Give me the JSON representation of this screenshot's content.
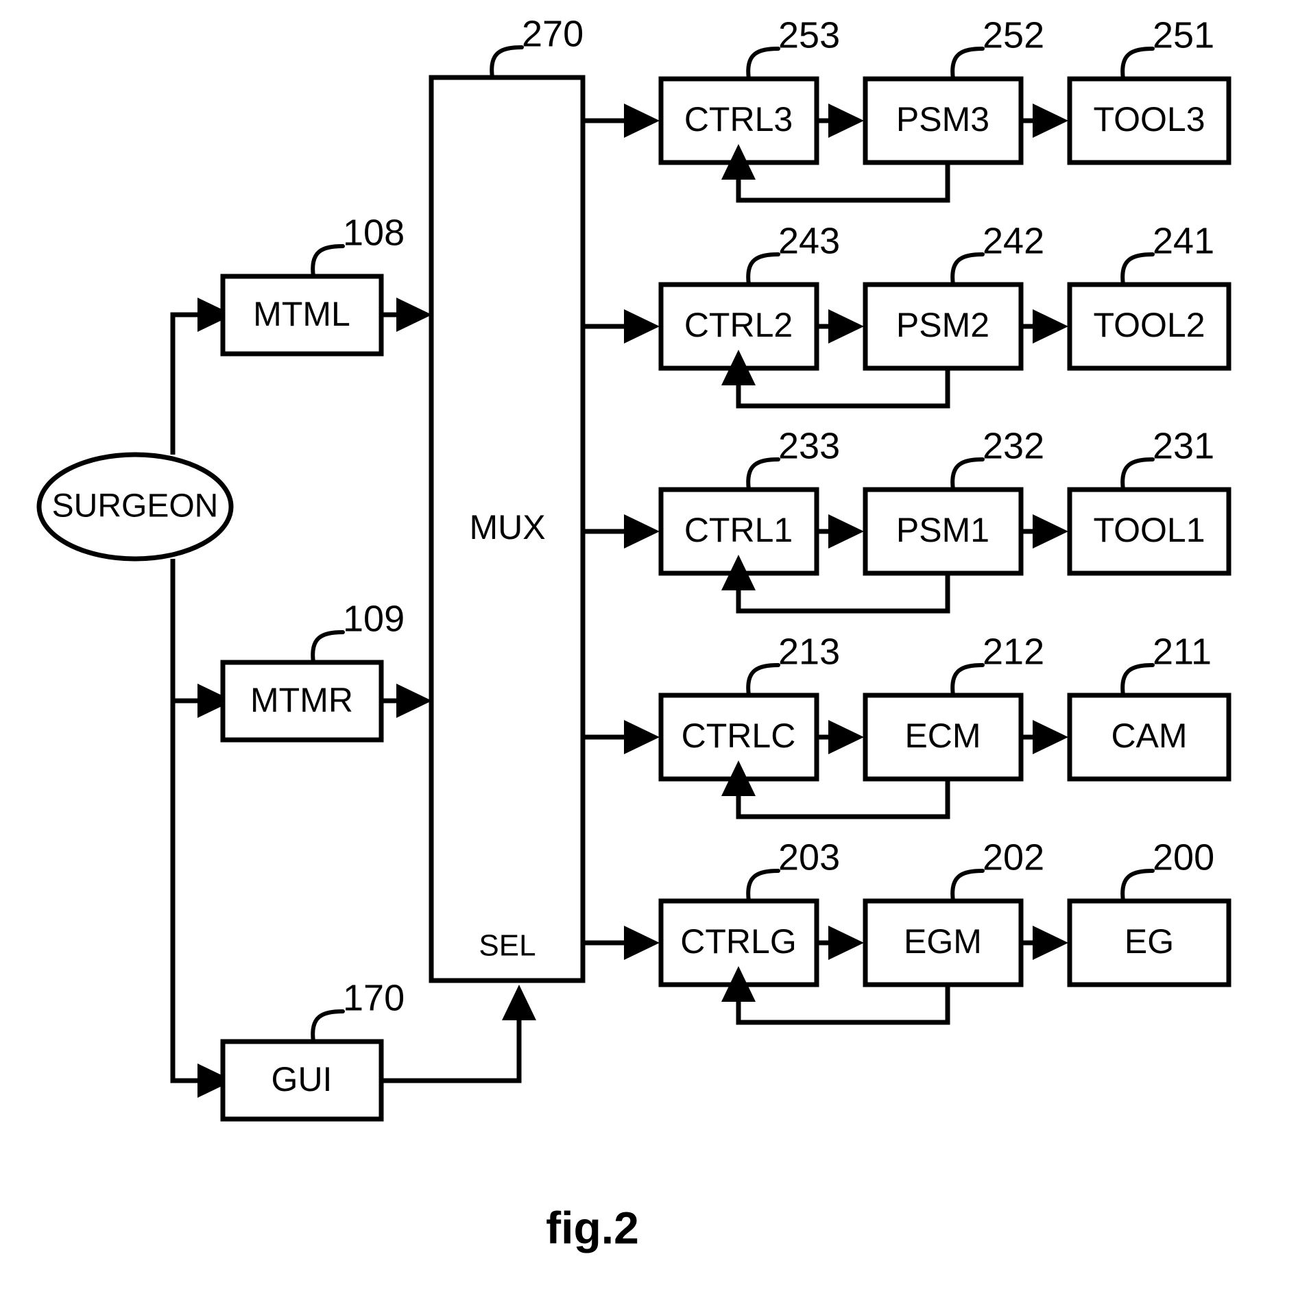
{
  "figure": {
    "caption": "fig.2",
    "type": "patent-block-diagram"
  },
  "actor": {
    "label": "SURGEON",
    "shape": "ellipse"
  },
  "mux": {
    "label": "MUX",
    "select_label": "SEL",
    "ref": "270"
  },
  "input_blocks": [
    {
      "id": "mtml",
      "label": "MTML",
      "ref": "108"
    },
    {
      "id": "mtmr",
      "label": "MTMR",
      "ref": "109"
    },
    {
      "id": "gui",
      "label": "GUI",
      "ref": "170"
    }
  ],
  "chains": [
    {
      "id": "chain-tool3",
      "controller": {
        "label": "CTRL3",
        "ref": "253"
      },
      "manipulator": {
        "label": "PSM3",
        "ref": "252"
      },
      "endeffector": {
        "label": "TOOL3",
        "ref": "251"
      }
    },
    {
      "id": "chain-tool2",
      "controller": {
        "label": "CTRL2",
        "ref": "243"
      },
      "manipulator": {
        "label": "PSM2",
        "ref": "242"
      },
      "endeffector": {
        "label": "TOOL2",
        "ref": "241"
      }
    },
    {
      "id": "chain-tool1",
      "controller": {
        "label": "CTRL1",
        "ref": "233"
      },
      "manipulator": {
        "label": "PSM1",
        "ref": "232"
      },
      "endeffector": {
        "label": "TOOL1",
        "ref": "231"
      }
    },
    {
      "id": "chain-cam",
      "controller": {
        "label": "CTRLC",
        "ref": "213"
      },
      "manipulator": {
        "label": "ECM",
        "ref": "212"
      },
      "endeffector": {
        "label": "CAM",
        "ref": "211"
      }
    },
    {
      "id": "chain-eg",
      "controller": {
        "label": "CTRLG",
        "ref": "203"
      },
      "manipulator": {
        "label": "EGM",
        "ref": "202"
      },
      "endeffector": {
        "label": "EG",
        "ref": "200"
      }
    }
  ],
  "colors": {
    "stroke": "#000000",
    "background": "#ffffff"
  }
}
